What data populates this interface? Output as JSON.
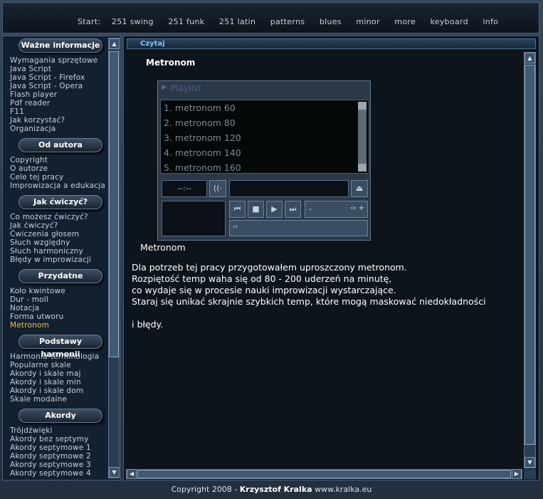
{
  "topnav": {
    "start_label": "Start:",
    "items": [
      "251 swing",
      "251 funk",
      "251 latin",
      "patterns",
      "blues",
      "minor",
      "more",
      "keyboard",
      "info"
    ]
  },
  "sidebar": {
    "sections": [
      {
        "title": "Ważne informacje",
        "items": [
          "Wymagania sprzętowe",
          "Java Script",
          "Java Script - Firefox",
          "Java Script - Opera",
          "Flash player",
          "Pdf reader",
          "F11",
          "Jak korzystać?",
          "Organizacja"
        ]
      },
      {
        "title": "Od autora",
        "items": [
          "Copyright",
          "O autorze",
          "Cele tej pracy",
          "Improwizacja a edukacja"
        ]
      },
      {
        "title": "Jak ćwiczyć?",
        "items": [
          "Co możesz ćwiczyć?",
          "Jak ćwiczyć?",
          "Ćwiczenia głosem",
          "Słuch względny",
          "Słuch harmoniczny",
          "Błędy w improwizacji"
        ]
      },
      {
        "title": "Przydatne",
        "items": [
          "Koło kwintowe",
          "Dur - moll",
          "Notacja",
          "Forma utworu",
          "Metronom"
        ]
      },
      {
        "title": "Podstawy harmonii",
        "items": [
          "Harmonia-terminologia",
          "Popularne skale",
          "Akordy i skale maj",
          "Akordy i skale min",
          "Akordy i skale dom",
          "Skale modalne"
        ]
      },
      {
        "title": "Akordy",
        "items": [
          "Trójdźwięki",
          "Akordy bez septymy",
          "Akordy septymowe 1",
          "Akordy septymowe 2",
          "Akordy septymowe 3",
          "Akordy septymowe 4"
        ]
      }
    ],
    "active_item": "Metronom"
  },
  "content": {
    "tab_label": "Czytaj",
    "page_title": "Metronom",
    "player": {
      "header": "Playlist",
      "tracks": [
        "1. metronom 60",
        "2. metronom 80",
        "3. metronom 120",
        "4. metronom 140",
        "5. metronom 160"
      ],
      "time": "--:--",
      "volume_label": "-",
      "controls": [
        "prev-icon",
        "stop-icon",
        "play-icon",
        "next-icon",
        "eject-icon"
      ]
    },
    "caption": "Metronom",
    "paragraph_lines": [
      "Dla potrzeb tej pracy przygotowałem uproszczony metronom.",
      "Rozpiętość temp waha się od 80 - 200 uderzeń na minutę,",
      "co wydaje się w procesie nauki improwizacji wystarczające.",
      "Staraj się unikać skrajnie szybkich temp, które mogą maskować niedokładności",
      "",
      "i błędy."
    ]
  },
  "footer": {
    "prefix": "Copyright 2008 - ",
    "author": "Krzysztof Kralka",
    "site": " www.kralka.eu"
  },
  "colors": {
    "accent": "#f0c040",
    "tab_text": "#8fc0ea",
    "background": "#0d141c"
  }
}
